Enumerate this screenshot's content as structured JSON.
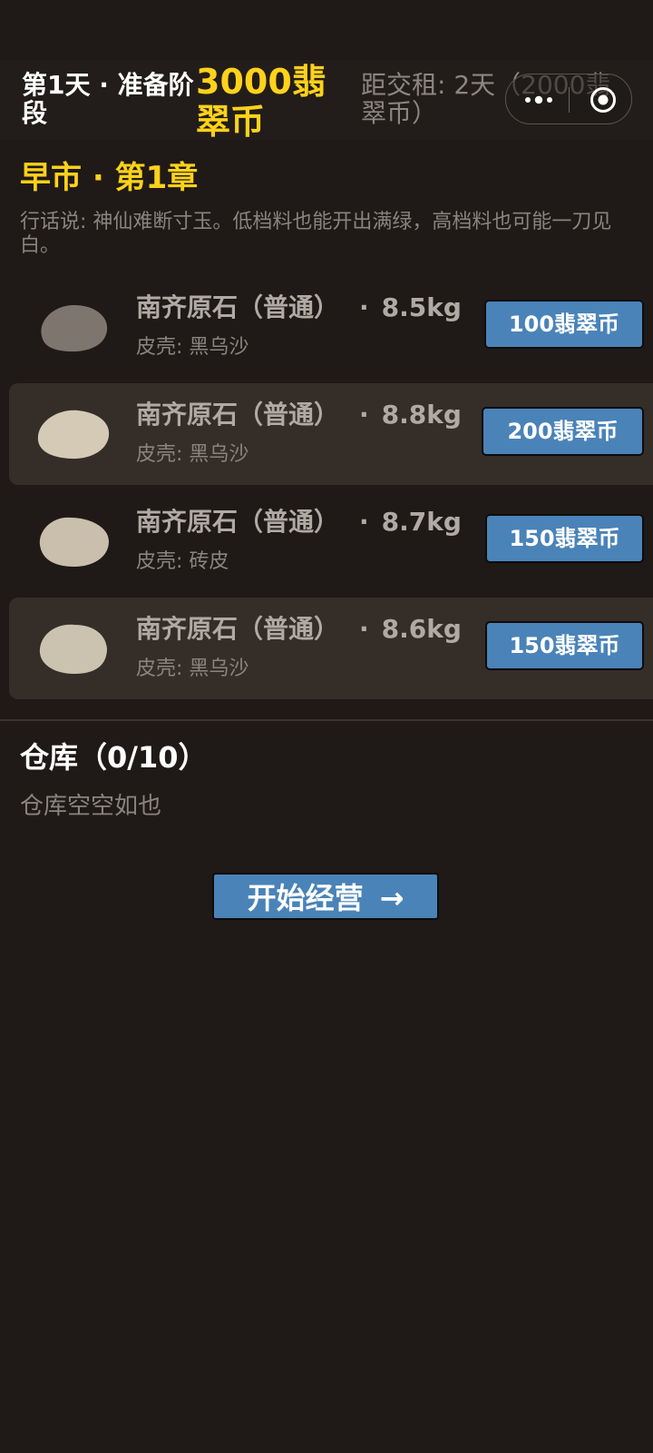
{
  "header": {
    "day_label": "第1天 · 准备阶段",
    "coins_label": "3000翡翠币",
    "rent_label": "距交租: 2天（2000翡翠币）"
  },
  "capsule": {
    "more_icon": "more-dots-icon",
    "close_icon": "target-icon"
  },
  "market": {
    "title": "早市 · 第1章",
    "saying": "行话说: 神仙难断寸玉。低档料也能开出满绿，高档料也可能一刀见白。"
  },
  "stones": [
    {
      "name": "南齐原石（普通）",
      "dot": "·",
      "weight": "8.5kg",
      "skin": "皮壳: 黑乌沙",
      "price_label": "100翡翠币",
      "color": "#7d756e"
    },
    {
      "name": "南齐原石（普通）",
      "dot": "·",
      "weight": "8.8kg",
      "skin": "皮壳: 黑乌沙",
      "price_label": "200翡翠币",
      "color": "#d5cab6"
    },
    {
      "name": "南齐原石（普通）",
      "dot": "·",
      "weight": "8.7kg",
      "skin": "皮壳: 砖皮",
      "price_label": "150翡翠币",
      "color": "#c9bfac"
    },
    {
      "name": "南齐原石（普通）",
      "dot": "·",
      "weight": "8.6kg",
      "skin": "皮壳: 黑乌沙",
      "price_label": "150翡翠币",
      "color": "#cbc2b0"
    }
  ],
  "warehouse": {
    "title": "仓库（0/10）",
    "empty_text": "仓库空空如也"
  },
  "start_button": {
    "label": "开始经营",
    "arrow": "→"
  },
  "colors": {
    "background": "#1f1a17",
    "accent_gold": "#ffd21a",
    "button_blue": "#4a83b8",
    "row_alt": "#352d28"
  }
}
